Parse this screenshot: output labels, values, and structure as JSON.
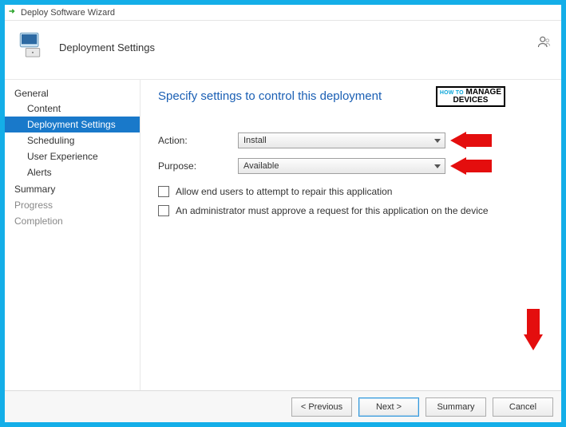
{
  "window": {
    "title": "Deploy Software Wizard"
  },
  "header": {
    "title": "Deployment Settings"
  },
  "sidebar": {
    "groups": [
      {
        "label": "General",
        "items": [
          {
            "label": "Content"
          },
          {
            "label": "Deployment Settings"
          },
          {
            "label": "Scheduling"
          },
          {
            "label": "User Experience"
          },
          {
            "label": "Alerts"
          }
        ]
      },
      {
        "label": "Summary",
        "items": []
      },
      {
        "label": "Progress",
        "items": []
      },
      {
        "label": "Completion",
        "items": []
      }
    ]
  },
  "content": {
    "heading": "Specify settings to control this deployment",
    "action": {
      "label": "Action:",
      "value": "Install"
    },
    "purpose": {
      "label": "Purpose:",
      "value": "Available"
    },
    "checkbox1": {
      "label": "Allow end users to attempt to repair this application",
      "checked": false
    },
    "checkbox2": {
      "label": "An administrator must approve a request for this application on the device",
      "checked": false
    }
  },
  "footer": {
    "previous": "< Previous",
    "next": "Next >",
    "summary": "Summary",
    "cancel": "Cancel"
  },
  "watermark": {
    "top": "MANAGE",
    "bottom": "DEVICES",
    "sub": "HOW TO"
  },
  "colors": {
    "accent": "#1979ca",
    "link": "#1a5fb4",
    "arrow": "#e40e0e"
  }
}
